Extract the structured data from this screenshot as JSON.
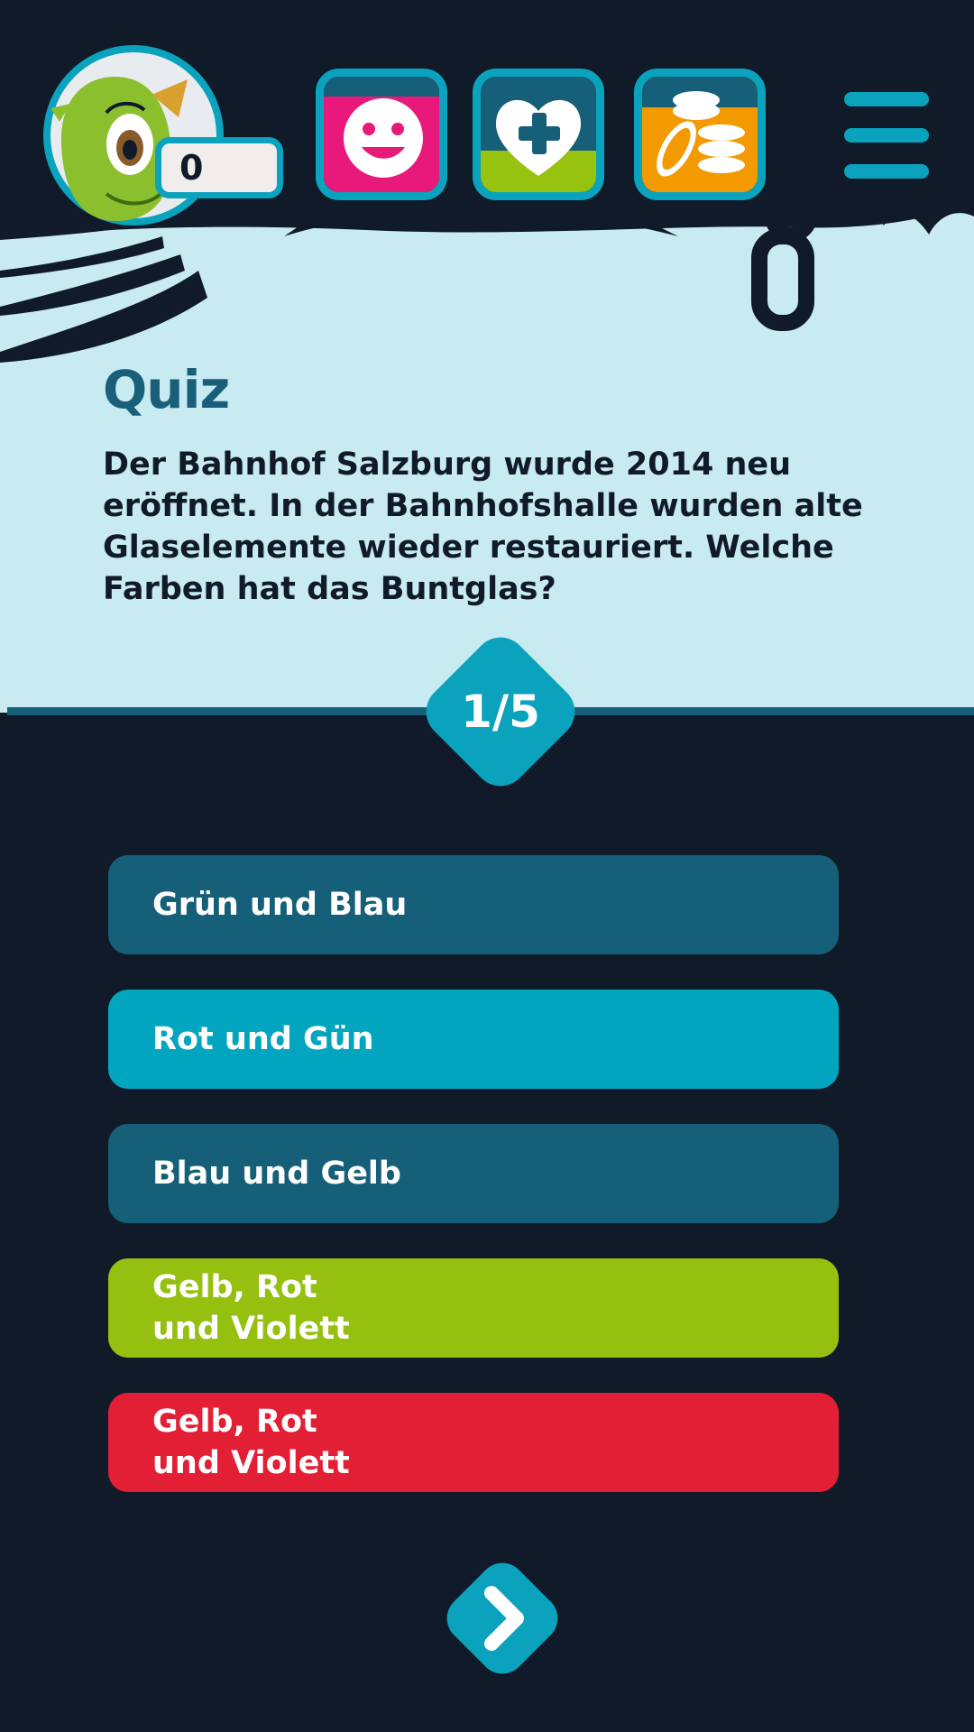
{
  "header": {
    "score": "0",
    "avatar_icon": "green-monster-mascot-icon",
    "buttons": [
      {
        "name": "mood",
        "icon": "smiley-face-icon",
        "top_color": "#155f78",
        "color": "#e8197a"
      },
      {
        "name": "health",
        "icon": "heart-plus-icon",
        "top_color": "#155f78",
        "color": "#97c20f"
      },
      {
        "name": "coins",
        "icon": "coins-stack-icon",
        "top_color": "#155f78",
        "color": "#f39a00"
      }
    ],
    "menu_icon": "hamburger-menu-icon"
  },
  "quiz": {
    "title": "Quiz",
    "question": "Der Bahnhof Salzburg wurde 2014 neu eröffnet. In der Bahnhofshalle wurden alte Glaselemente wieder restauriert. Welche Farben hat das Buntglas?",
    "progress": "1/5"
  },
  "answers": [
    {
      "label": "Grün und Blau",
      "color": "#155f78"
    },
    {
      "label": "Rot und Gün",
      "color": "#02a5bf"
    },
    {
      "label": "Blau und Gelb",
      "color": "#155f78"
    },
    {
      "label": "Gelb, Rot\nund Violett",
      "color": "#96c010"
    },
    {
      "label": "Gelb, Rot\nund Violett",
      "color": "#e31f36"
    }
  ],
  "next_icon": "chevron-right-icon",
  "colors": {
    "dark_background": "#101a28",
    "light_background": "#c8eaf1",
    "accent": "#0aa2bc",
    "title": "#1a5f7a"
  }
}
